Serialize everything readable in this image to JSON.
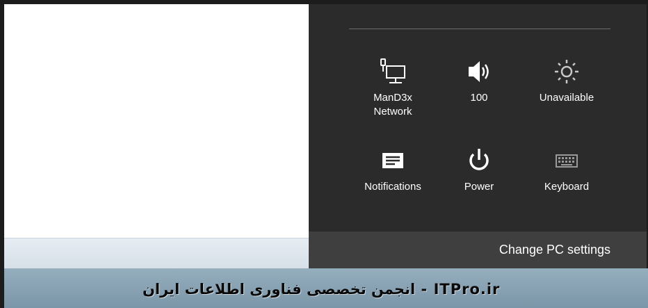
{
  "settings_panel": {
    "tiles": [
      {
        "icon": "network-icon",
        "label_line1": "ManD3x",
        "label_line2": "Network"
      },
      {
        "icon": "volume-icon",
        "label_line1": "100",
        "label_line2": ""
      },
      {
        "icon": "brightness-icon",
        "label_line1": "Unavailable",
        "label_line2": ""
      },
      {
        "icon": "notifications-icon",
        "label_line1": "Notifications",
        "label_line2": ""
      },
      {
        "icon": "power-icon",
        "label_line1": "Power",
        "label_line2": ""
      },
      {
        "icon": "keyboard-icon",
        "label_line1": "Keyboard",
        "label_line2": ""
      }
    ],
    "change_pc_settings": "Change PC settings",
    "background": "#2b2b2b",
    "footer_background": "#3f3f3f"
  },
  "watermark": "ITPro.ir - انجمن تخصصی فناوری اطلاعات ایران"
}
